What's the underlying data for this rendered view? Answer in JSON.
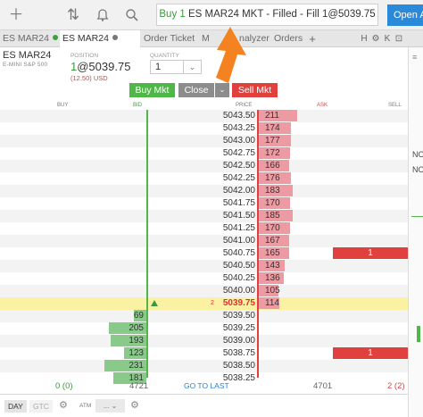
{
  "toolbar": {
    "notification": {
      "fill_text": "Buy 1",
      "detail_text": "ES MAR24 MKT - Filled - Fill 1@5039.75"
    },
    "open_button_label": "Open A"
  },
  "tabs": [
    {
      "label": "ES MAR24",
      "dot_color": "#3aa23a"
    },
    {
      "label": "ES MAR24",
      "dot_color": "#777777"
    },
    {
      "label": "Order Ticket"
    },
    {
      "label": "M"
    },
    {
      "label": "nalyzer"
    },
    {
      "label": "Orders"
    }
  ],
  "tab_controls": [
    "+",
    "H",
    "⚙",
    "K",
    "⊡"
  ],
  "header": {
    "symbol": "ES MAR24",
    "description": "E-MINI S&P 500",
    "position_label": "POSITION",
    "position_qty": "1",
    "position_at": "@5039.75",
    "pnl": "(12.50) USD",
    "quantity_label": "QUANTITY",
    "quantity_value": "1"
  },
  "buttons": {
    "buy_mkt": "Buy Mkt",
    "close": "Close",
    "sell_mkt": "Sell Mkt"
  },
  "columns": {
    "buy": "BUY",
    "bid": "BID",
    "price": "PRICE",
    "ask": "ASK",
    "sell": "SELL"
  },
  "ladder": [
    {
      "price": "5043.50",
      "ask": "211"
    },
    {
      "price": "5043.25",
      "ask": "174"
    },
    {
      "price": "5043.00",
      "ask": "177"
    },
    {
      "price": "5042.75",
      "ask": "172"
    },
    {
      "price": "5042.50",
      "ask": "166"
    },
    {
      "price": "5042.25",
      "ask": "176"
    },
    {
      "price": "5042.00",
      "ask": "183"
    },
    {
      "price": "5041.75",
      "ask": "170"
    },
    {
      "price": "5041.50",
      "ask": "185"
    },
    {
      "price": "5041.25",
      "ask": "170"
    },
    {
      "price": "5041.00",
      "ask": "167"
    },
    {
      "price": "5040.75",
      "ask": "165",
      "sell_order": "1"
    },
    {
      "price": "5040.50",
      "ask": "143"
    },
    {
      "price": "5040.25",
      "ask": "136"
    },
    {
      "price": "5040.00",
      "ask": "105"
    },
    {
      "price": "5039.75",
      "ask": "114",
      "last": true,
      "last_qty": "2"
    },
    {
      "price": "5039.50",
      "bid": "69"
    },
    {
      "price": "5039.25",
      "bid": "205"
    },
    {
      "price": "5039.00",
      "bid": "193"
    },
    {
      "price": "5038.75",
      "bid": "123",
      "sell_order": "1"
    },
    {
      "price": "5038.50",
      "bid": "231"
    },
    {
      "price": "5038.25",
      "bid": "181"
    }
  ],
  "totals": {
    "buy_total": "0 (0)",
    "bid_total": "4721",
    "go_to_last": "GO TO LAST",
    "ask_total": "4701",
    "sell_total": "2 (2)"
  },
  "footer": {
    "day": "DAY",
    "gtc": "GTC",
    "atm_label": "ATM",
    "atm_value": "..."
  },
  "right_panel": {
    "line1": "NO",
    "line2": "NO"
  },
  "colors": {
    "bid_bar": "#89c98a",
    "ask_bar": "#ee9aa2",
    "buy_green": "#4fb748",
    "sell_red": "#e0413e",
    "last_highlight": "#fbf1a3",
    "arrow": "#f58220"
  }
}
